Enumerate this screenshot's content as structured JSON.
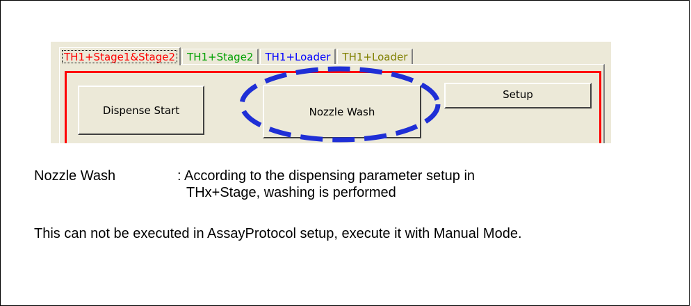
{
  "tabs": [
    {
      "label": "TH1+Stage1&Stage2",
      "color": "#ff0000",
      "active": true
    },
    {
      "label": "TH1+Stage2",
      "color": "#00a000",
      "active": false
    },
    {
      "label": "TH1+Loader",
      "color": "#0000ff",
      "active": false
    },
    {
      "label": "TH1+Loader",
      "color": "#808000",
      "active": false
    }
  ],
  "buttons": {
    "dispense_start": "Dispense Start",
    "nozzle_wash": "Nozzle Wash",
    "setup": "Setup"
  },
  "highlight": {
    "color": "#1f2fd6",
    "style": "dashed ellipse",
    "target": "Nozzle Wash"
  },
  "description": {
    "term": "Nozzle Wash",
    "definition_line1": ": According to the dispensing parameter setup in",
    "definition_line2": "THx+Stage, washing is performed",
    "note": "This can not be executed in AssayProtocol setup, execute it with Manual Mode."
  }
}
